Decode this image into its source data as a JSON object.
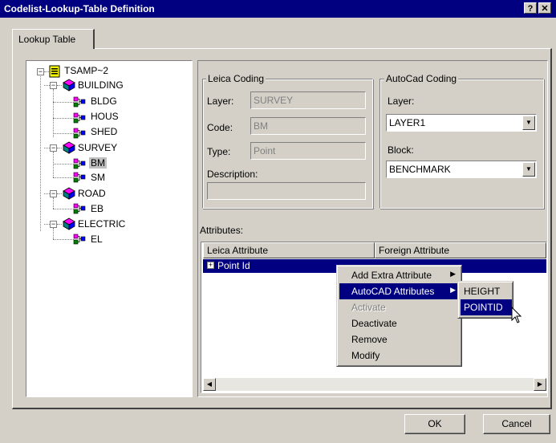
{
  "window": {
    "title": "Codelist-Lookup-Table Definition",
    "help_glyph": "?",
    "close_glyph": "✕"
  },
  "tabs": [
    {
      "label": "Lookup Table"
    }
  ],
  "tree": {
    "root": "TSAMP~2",
    "groups": [
      {
        "label": "BUILDING",
        "children": [
          "BLDG",
          "HOUS",
          "SHED"
        ]
      },
      {
        "label": "SURVEY",
        "children": [
          "BM",
          "SM"
        ]
      },
      {
        "label": "ROAD",
        "children": [
          "EB"
        ]
      },
      {
        "label": "ELECTRIC",
        "children": [
          "EL"
        ]
      }
    ],
    "selected": "BM"
  },
  "leica_coding": {
    "title": "Leica Coding",
    "layer_label": "Layer:",
    "layer_value": "SURVEY",
    "code_label": "Code:",
    "code_value": "BM",
    "type_label": "Type:",
    "type_value": "Point",
    "description_label": "Description:",
    "description_value": ""
  },
  "autocad_coding": {
    "title": "AutoCad Coding",
    "layer_label": "Layer:",
    "layer_value": "LAYER1",
    "block_label": "Block:",
    "block_value": "BENCHMARK"
  },
  "attributes": {
    "label": "Attributes:",
    "columns": [
      "Leica Attribute",
      "Foreign Attribute"
    ],
    "rows": [
      {
        "leica": "Point Id",
        "foreign": ""
      }
    ]
  },
  "context_menu": {
    "items": [
      {
        "label": "Add Extra Attribute",
        "submenu": true,
        "enabled": true
      },
      {
        "label": "AutoCAD Attributes",
        "submenu": true,
        "enabled": true,
        "highlighted": true
      },
      {
        "label": "Activate",
        "enabled": false
      },
      {
        "label": "Deactivate",
        "enabled": true
      },
      {
        "label": "Remove",
        "enabled": true
      },
      {
        "label": "Modify",
        "enabled": true
      }
    ],
    "submenu_items": [
      {
        "label": "HEIGHT"
      },
      {
        "label": "POINTID",
        "highlighted": true
      }
    ]
  },
  "buttons": {
    "ok": "OK",
    "cancel": "Cancel"
  },
  "colors": {
    "selection": "#000080",
    "face": "#d4d0c8"
  }
}
